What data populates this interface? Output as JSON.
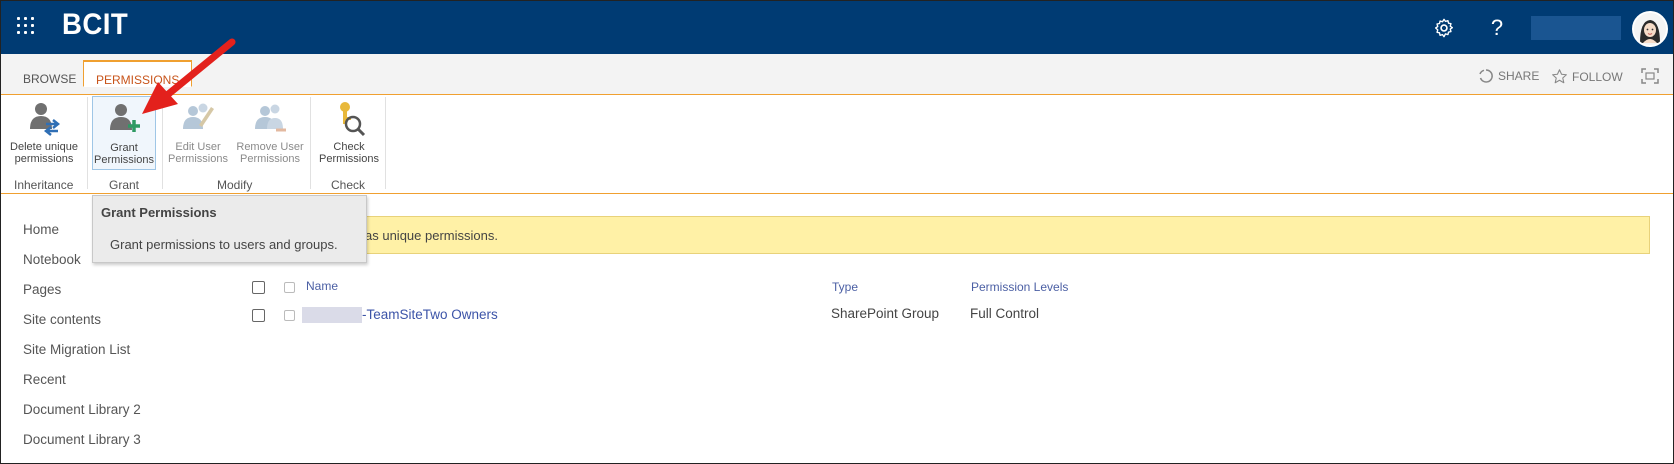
{
  "suitebar": {
    "brand": "BCIT",
    "settings_icon": "gear-icon",
    "help_label": "?",
    "background": "#003b73"
  },
  "ribbon_tabs": {
    "browse": "BROWSE",
    "permissions": "PERMISSIONS"
  },
  "page_actions": {
    "share": "SHARE",
    "follow": "FOLLOW"
  },
  "ribbon": {
    "buttons": [
      {
        "line1": "Delete unique",
        "line2": "permissions",
        "icon": "delete-unique-permissions-icon"
      },
      {
        "line1": "Grant",
        "line2": "Permissions",
        "icon": "grant-permissions-icon"
      },
      {
        "line1": "Edit User",
        "line2": "Permissions",
        "icon": "edit-user-permissions-icon"
      },
      {
        "line1": "Remove User",
        "line2": "Permissions",
        "icon": "remove-user-permissions-icon"
      },
      {
        "line1": "Check",
        "line2": "Permissions",
        "icon": "check-permissions-icon"
      }
    ],
    "groups": [
      "Inheritance",
      "Grant",
      "Modify",
      "Check"
    ]
  },
  "tooltip": {
    "title": "Grant Permissions",
    "body": "Grant permissions to users and groups."
  },
  "nav": {
    "items": [
      "Home",
      "Notebook",
      "Pages",
      "Site contents",
      "Site Migration List",
      "Recent",
      "Document Library 2",
      "Document Library 3"
    ]
  },
  "message": {
    "text": "as unique permissions."
  },
  "table": {
    "columns": {
      "name": "Name",
      "type": "Type",
      "permission_levels": "Permission Levels"
    },
    "rows": [
      {
        "name": "-TeamSiteTwo Owners",
        "type": "SharePoint Group",
        "permission_levels": "Full Control"
      }
    ]
  },
  "colors": {
    "accent_orange": "#f0a030",
    "tab_active_text": "#c8541a",
    "link_blue": "#3c54a8",
    "message_bg": "#fff1a6",
    "annotation_arrow": "#e3211c"
  }
}
